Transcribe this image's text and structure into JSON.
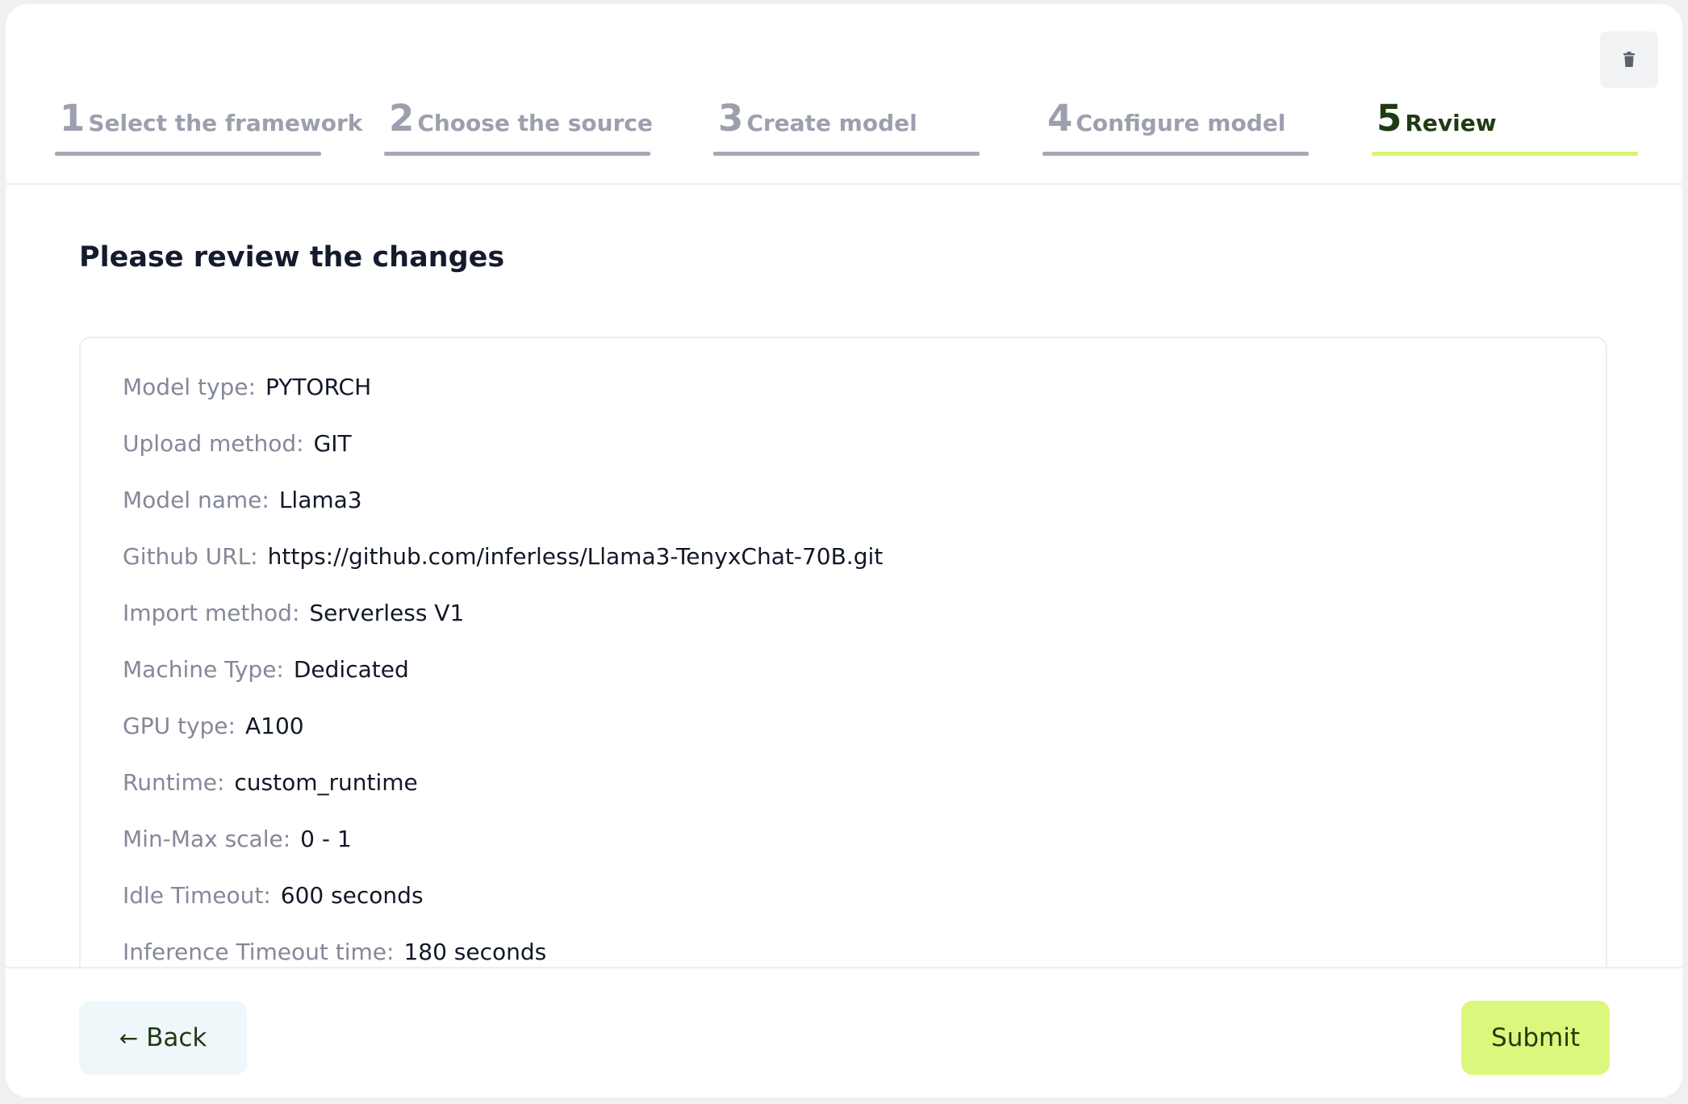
{
  "steps": [
    {
      "number": "1",
      "label": "Select the framework"
    },
    {
      "number": "2",
      "label": "Choose the source"
    },
    {
      "number": "3",
      "label": "Create model"
    },
    {
      "number": "4",
      "label": "Configure model"
    },
    {
      "number": "5",
      "label": "Review"
    }
  ],
  "active_step": 5,
  "icons": {
    "delete": "trash-icon",
    "back": "arrow-left-icon"
  },
  "page": {
    "title": "Please review the changes"
  },
  "review": [
    {
      "key": "Model type:",
      "value": "PYTORCH"
    },
    {
      "key": "Upload method:",
      "value": "GIT"
    },
    {
      "key": "Model name:",
      "value": "Llama3"
    },
    {
      "key": "Github URL:",
      "value": "https://github.com/inferless/Llama3-TenyxChat-70B.git"
    },
    {
      "key": "Import method:",
      "value": "Serverless V1"
    },
    {
      "key": "Machine Type:",
      "value": "Dedicated"
    },
    {
      "key": "GPU type:",
      "value": "A100"
    },
    {
      "key": "Runtime:",
      "value": "custom_runtime"
    },
    {
      "key": "Min-Max scale:",
      "value": "0 - 1"
    },
    {
      "key": "Idle Timeout:",
      "value": "600 seconds"
    },
    {
      "key": "Inference Timeout time:",
      "value": "180 seconds"
    }
  ],
  "footer": {
    "back_label": "Back",
    "submit_label": "Submit"
  },
  "colors": {
    "accent": "#d7f56f",
    "accent_text": "#1f3b12",
    "muted": "#9ca0ae"
  }
}
